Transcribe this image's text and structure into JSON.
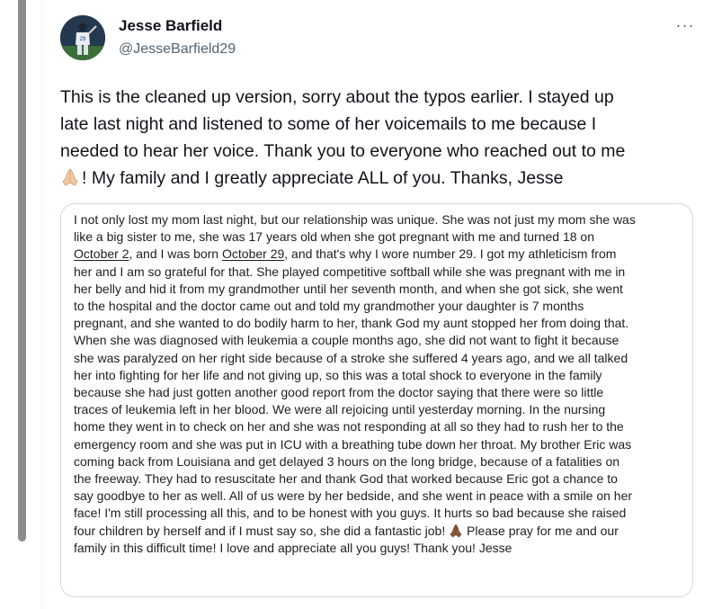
{
  "author": {
    "display_name": "Jesse Barfield",
    "handle": "@JesseBarfield29",
    "avatar_jersey_number": "29"
  },
  "more_icon": "···",
  "tweet": {
    "lines": [
      "This is the cleaned up version, sorry about the typos earlier. I stayed up",
      "late last night and listened to some of her voicemails to me because I",
      "needed to hear her voice. Thank you to everyone who reached out to me",
      "! My family and I greatly appreciate ALL of you. Thanks, Jesse"
    ]
  },
  "image_text": {
    "line_01": "I not only lost my mom last night, but our relationship was unique. She was not just my mom she was",
    "line_02": "like a big sister to me, she was 17 years old when she got pregnant with me and turned 18 on",
    "line_03_link": "October 2",
    "line_03_rest": ", and I was born ",
    "line_03_link2": "October 29",
    "line_03_end": ", and that's why I wore number 29. I got my athleticism from",
    "line_04": "her and I am so grateful for that. She played competitive softball while she was pregnant with me in",
    "line_05": "her belly and hid it from my grandmother until her seventh month, and when she got sick, she went",
    "line_06": "to the hospital and the doctor came out and told my grandmother your daughter is 7 months",
    "line_07": "pregnant, and she wanted to do bodily harm to her, thank God my aunt stopped her from doing that.",
    "line_08": "When she was diagnosed with leukemia a couple months ago, she did not want to fight it because",
    "line_09": "she was paralyzed on her right side because of a stroke she suffered 4 years ago, and we all talked",
    "line_10": "her into fighting for her life and not giving up, so this was a total shock to everyone in the family",
    "line_11": "because she had just gotten another good report from the doctor saying that there were so little",
    "line_12": "traces of leukemia left in her blood. We were all rejoicing until yesterday morning. In the nursing",
    "line_13": "home they went in to check on her and she was not responding at all so they had to rush her to the",
    "line_14": "emergency room and she was put in ICU with a breathing tube down her throat. My brother Eric was",
    "line_15": "coming back from Louisiana and get delayed 3 hours on the long bridge, because of a fatalities on",
    "line_16": "the freeway. They had to resuscitate her and thank God that worked because Eric got a chance to",
    "line_17": "say goodbye to her as well. All of us were by her bedside, and she went in peace with a smile on her",
    "line_18": "face! I'm still processing all this, and to be honest with you guys. It hurts so bad because she raised",
    "line_19_start": "four children by herself and if I must say so, she did a fantastic job! ",
    "line_19_end": " Please pray for me and our",
    "line_20": "family in this difficult time! I love and appreciate all you guys! Thank you! Jesse"
  },
  "colors": {
    "text_primary": "#0f1419",
    "text_secondary": "#536471",
    "border": "#cfd9de",
    "skin_light": "#f2c8a0",
    "skin_dark": "#8a5a3c"
  },
  "icons": {
    "more": "more-horizontal-icon",
    "emoji_tweet": "folded-hands-light-skin-emoji",
    "emoji_image": "folded-hands-dark-skin-emoji"
  }
}
